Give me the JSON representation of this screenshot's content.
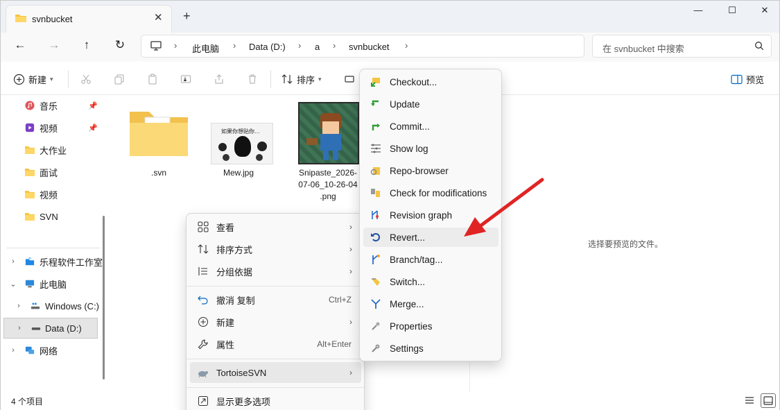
{
  "window": {
    "tab_title": "svnbucket",
    "tab_close": "✕",
    "new_tab": "+",
    "min": "—",
    "max": "☐",
    "close": "✕"
  },
  "nav": {
    "back": "←",
    "forward": "→",
    "up": "↑",
    "refresh": "↻"
  },
  "address": {
    "crumbs": [
      "此电脑",
      "Data (D:)",
      "a",
      "svnbucket"
    ],
    "sep": "›"
  },
  "search": {
    "placeholder": "在 svnbucket 中搜索"
  },
  "toolbar": {
    "new_label": "新建",
    "sort_label": "排序",
    "preview_label": "预览"
  },
  "sidebar": {
    "items": [
      {
        "label": "音乐",
        "icon": "music-icon",
        "pinned": true
      },
      {
        "label": "视频",
        "icon": "video-icon",
        "pinned": true
      },
      {
        "label": "大作业",
        "icon": "folder-icon"
      },
      {
        "label": "面试",
        "icon": "folder-icon"
      },
      {
        "label": "视频",
        "icon": "folder-icon"
      },
      {
        "label": "SVN",
        "icon": "folder-icon"
      },
      {
        "label": "乐程软件工作室",
        "icon": "cloud-folder-icon"
      },
      {
        "label": "此电脑",
        "icon": "pc-icon"
      },
      {
        "label": "Windows (C:)",
        "icon": "drive-icon"
      },
      {
        "label": "Data (D:)",
        "icon": "drive-icon"
      },
      {
        "label": "网络",
        "icon": "network-icon"
      }
    ]
  },
  "files": [
    {
      "name": ".svn"
    },
    {
      "name": "Mew.jpg",
      "thumb_text": "如果你想贴你…"
    },
    {
      "name_line1": "Snipaste_2026-",
      "name_line2": "07-06_10-26-04",
      "name_line3": ".png"
    }
  ],
  "preview": {
    "empty_text": "选择要预览的文件。"
  },
  "status": {
    "count": "4 个项目"
  },
  "context_menu": {
    "items": [
      {
        "label": "查看",
        "icon": "grid-icon"
      },
      {
        "label": "排序方式",
        "icon": "sort-icon"
      },
      {
        "label": "分组依据",
        "icon": "group-icon"
      },
      {
        "label": "撤消 复制",
        "icon": "undo-icon",
        "shortcut": "Ctrl+Z"
      },
      {
        "label": "新建",
        "icon": "new-icon"
      },
      {
        "label": "属性",
        "icon": "properties-icon",
        "shortcut": "Alt+Enter"
      },
      {
        "label": "TortoiseSVN",
        "icon": "tortoise-icon"
      },
      {
        "label": "显示更多选项",
        "icon": "more-options-icon"
      }
    ],
    "submenu_arrow": "›"
  },
  "submenu": {
    "items": [
      {
        "label": "Checkout...",
        "icon": "checkout-icon"
      },
      {
        "label": "Update",
        "icon": "update-icon"
      },
      {
        "label": "Commit...",
        "icon": "commit-icon"
      },
      {
        "label": "Show log",
        "icon": "log-icon"
      },
      {
        "label": "Repo-browser",
        "icon": "repo-browser-icon"
      },
      {
        "label": "Check for modifications",
        "icon": "check-modifications-icon"
      },
      {
        "label": "Revision graph",
        "icon": "revision-graph-icon"
      },
      {
        "label": "Revert...",
        "icon": "revert-icon"
      },
      {
        "label": "Branch/tag...",
        "icon": "branch-icon"
      },
      {
        "label": "Switch...",
        "icon": "switch-icon"
      },
      {
        "label": "Merge...",
        "icon": "merge-icon"
      },
      {
        "label": "Properties",
        "icon": "properties-icon"
      },
      {
        "label": "Settings",
        "icon": "settings-icon"
      }
    ]
  },
  "colors": {
    "accent": "#0067c0",
    "folder": "#f5c542",
    "arrow": "#e02424"
  }
}
